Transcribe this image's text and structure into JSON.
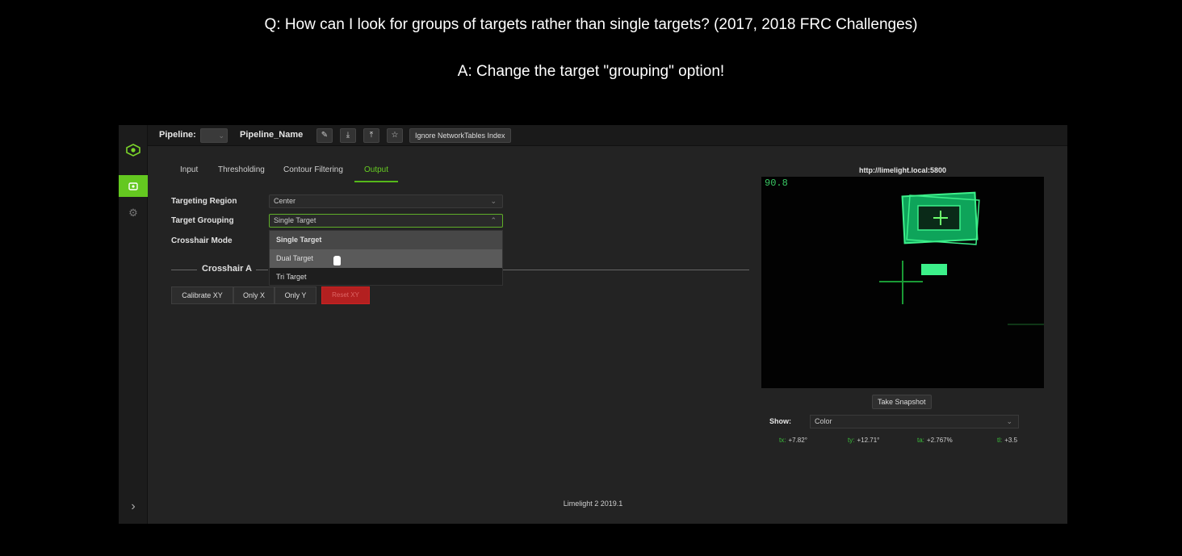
{
  "caption": {
    "question": "Q: How can I look for groups of targets rather than single targets? (2017, 2018 FRC Challenges)",
    "answer": "A: Change the target \"grouping\" option!"
  },
  "topbar": {
    "pipeline_label": "Pipeline:",
    "pipeline_name": "Pipeline_Name",
    "ignore_button": "Ignore NetworkTables Index",
    "icons": [
      "edit-icon",
      "download-icon",
      "upload-icon",
      "star-icon"
    ]
  },
  "tabs": [
    "Input",
    "Thresholding",
    "Contour Filtering",
    "Output"
  ],
  "active_tab": "Output",
  "form": {
    "targeting_region_label": "Targeting Region",
    "targeting_region_value": "Center",
    "target_grouping_label": "Target Grouping",
    "target_grouping_value": "Single Target",
    "crosshair_mode_label": "Crosshair Mode"
  },
  "dropdown": {
    "options": [
      "Single Target",
      "Dual Target",
      "Tri Target"
    ],
    "selected": "Single Target",
    "hovered": "Dual Target"
  },
  "crosshair": {
    "title": "Crosshair A",
    "buttons": [
      "Calibrate XY",
      "Only X",
      "Only Y",
      "Reset XY"
    ]
  },
  "camera": {
    "url": "http://limelight.local:5800",
    "fps": "90.8",
    "snapshot_button": "Take Snapshot",
    "show_label": "Show:",
    "show_value": "Color",
    "target_color": "#3cf08a"
  },
  "stats": [
    {
      "key": "tx:",
      "value": "+7.82°"
    },
    {
      "key": "ty:",
      "value": "+12.71°"
    },
    {
      "key": "ta:",
      "value": "+2.767%"
    },
    {
      "key": "tl:",
      "value": "+3.5"
    }
  ],
  "footer": "Limelight 2 2019.1",
  "colors": {
    "accent": "#64c820",
    "background": "#232323",
    "danger": "#b32020"
  }
}
